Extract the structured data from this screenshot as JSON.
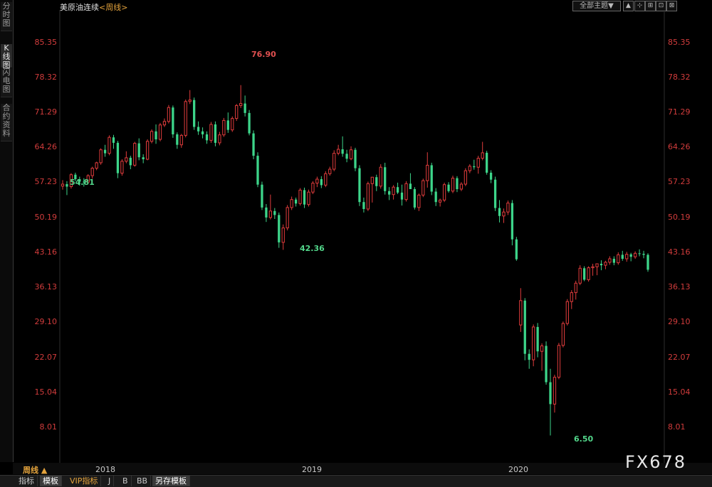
{
  "left_tabs": [
    {
      "label": "分时图"
    },
    {
      "label": "K线图",
      "active": true
    },
    {
      "label": "闪电图"
    },
    {
      "label": "合约资料"
    }
  ],
  "header": {
    "instrument": "美原油连续",
    "period_prefix": "<",
    "period": "周线",
    "period_suffix": ">",
    "theme_selector": "全部主题▼",
    "tool_buttons": [
      "▲",
      "⊹",
      "⊞",
      "⊡",
      "⊠"
    ]
  },
  "y_ticks": [
    "85.35",
    "78.32",
    "71.29",
    "64.26",
    "57.23",
    "50.19",
    "43.16",
    "36.13",
    "29.10",
    "22.07",
    "15.04",
    "8.01"
  ],
  "x_ticks": [
    "2018",
    "2019",
    "2020"
  ],
  "annotations": {
    "high_2018": "76.90",
    "low_2017": "54.81",
    "low_2018": "42.36",
    "low_2020": "6.50"
  },
  "period_label": "周线 ▲",
  "watermark": "FX678",
  "bottom_tabs": [
    {
      "label": "指标"
    },
    {
      "label": "模板",
      "active": true
    },
    {
      "label": "VIP指标",
      "vip": true
    },
    {
      "label": "J"
    },
    {
      "label": "B"
    },
    {
      "label": "BB"
    },
    {
      "label": "另存模板",
      "active": true
    }
  ],
  "colors": {
    "up": "#e03c3c",
    "down": "#3dd58a",
    "axis_text": "#d23c3c"
  },
  "chart_data": {
    "type": "candlestick",
    "title": "美原油连续",
    "period": "周线",
    "ylim": [
      1.0,
      92.0
    ],
    "x_labels": [
      "2018",
      "2019",
      "2020"
    ],
    "series": [
      {
        "name": "美原油连续",
        "candles": [
          [
            56.6,
            57.8,
            55.9,
            57.0
          ],
          [
            57.0,
            57.6,
            54.8,
            56.5
          ],
          [
            56.5,
            59.2,
            56.1,
            58.9
          ],
          [
            58.9,
            59.3,
            57.6,
            58.0
          ],
          [
            58.0,
            58.5,
            56.7,
            57.5
          ],
          [
            57.5,
            58.2,
            56.5,
            57.4
          ],
          [
            57.4,
            59.0,
            57.0,
            58.7
          ],
          [
            58.7,
            60.5,
            58.1,
            60.2
          ],
          [
            60.2,
            61.5,
            59.8,
            61.3
          ],
          [
            61.3,
            64.2,
            60.9,
            63.9
          ],
          [
            63.9,
            64.9,
            62.5,
            63.2
          ],
          [
            63.2,
            66.8,
            62.8,
            66.4
          ],
          [
            66.4,
            66.9,
            64.1,
            65.3
          ],
          [
            65.3,
            65.7,
            58.2,
            59.2
          ],
          [
            59.2,
            62.0,
            58.7,
            61.6
          ],
          [
            61.6,
            63.6,
            61.2,
            62.3
          ],
          [
            62.3,
            62.7,
            60.0,
            60.8
          ],
          [
            60.8,
            65.5,
            60.5,
            65.2
          ],
          [
            65.2,
            66.2,
            61.8,
            62.4
          ],
          [
            62.4,
            63.0,
            61.2,
            62.0
          ],
          [
            62.0,
            66.0,
            61.8,
            65.6
          ],
          [
            65.6,
            68.0,
            65.2,
            67.6
          ],
          [
            67.6,
            69.0,
            65.1,
            66.0
          ],
          [
            66.0,
            69.3,
            65.6,
            68.9
          ],
          [
            68.9,
            70.2,
            68.5,
            69.6
          ],
          [
            69.6,
            72.9,
            69.2,
            72.4
          ],
          [
            72.4,
            72.8,
            66.3,
            67.0
          ],
          [
            67.0,
            67.4,
            64.1,
            64.9
          ],
          [
            64.9,
            67.1,
            64.3,
            66.8
          ],
          [
            66.8,
            74.0,
            66.4,
            73.6
          ],
          [
            73.6,
            75.9,
            73.1,
            73.9
          ],
          [
            73.9,
            74.4,
            67.9,
            68.5
          ],
          [
            68.5,
            69.6,
            66.9,
            67.6
          ],
          [
            67.6,
            68.4,
            66.2,
            67.0
          ],
          [
            67.0,
            67.6,
            65.1,
            65.8
          ],
          [
            65.8,
            69.5,
            65.3,
            69.0
          ],
          [
            69.0,
            69.6,
            64.6,
            65.3
          ],
          [
            65.3,
            67.5,
            64.8,
            66.9
          ],
          [
            66.9,
            70.3,
            66.5,
            69.8
          ],
          [
            69.8,
            71.4,
            67.3,
            67.9
          ],
          [
            67.9,
            70.6,
            67.5,
            70.2
          ],
          [
            70.2,
            73.1,
            69.7,
            72.8
          ],
          [
            72.8,
            76.9,
            72.3,
            73.2
          ],
          [
            73.2,
            74.8,
            70.6,
            71.3
          ],
          [
            71.3,
            71.9,
            66.8,
            67.2
          ],
          [
            67.2,
            67.8,
            62.0,
            62.7
          ],
          [
            62.7,
            63.4,
            56.4,
            56.9
          ],
          [
            56.9,
            57.5,
            51.8,
            52.3
          ],
          [
            52.3,
            53.0,
            49.4,
            50.3
          ],
          [
            50.3,
            54.9,
            49.9,
            51.6
          ],
          [
            51.6,
            52.2,
            50.0,
            50.8
          ],
          [
            50.8,
            51.3,
            44.2,
            45.3
          ],
          [
            45.3,
            48.9,
            43.8,
            48.2
          ],
          [
            48.2,
            52.8,
            47.7,
            52.3
          ],
          [
            52.3,
            54.5,
            51.8,
            53.9
          ],
          [
            53.9,
            54.3,
            52.5,
            53.1
          ],
          [
            53.1,
            56.2,
            52.7,
            55.8
          ],
          [
            55.8,
            56.3,
            52.2,
            52.9
          ],
          [
            52.9,
            55.9,
            52.5,
            55.4
          ],
          [
            55.4,
            57.6,
            55.0,
            57.2
          ],
          [
            57.2,
            58.5,
            56.4,
            58.0
          ],
          [
            58.0,
            58.6,
            56.2,
            56.8
          ],
          [
            56.8,
            59.6,
            56.4,
            59.1
          ],
          [
            59.1,
            60.5,
            58.7,
            60.0
          ],
          [
            60.0,
            63.8,
            59.6,
            63.2
          ],
          [
            63.2,
            64.9,
            62.8,
            64.0
          ],
          [
            64.0,
            66.6,
            62.5,
            63.1
          ],
          [
            63.1,
            63.9,
            61.4,
            62.1
          ],
          [
            62.1,
            64.6,
            61.8,
            63.9
          ],
          [
            63.9,
            64.3,
            59.6,
            60.2
          ],
          [
            60.2,
            60.8,
            52.6,
            53.4
          ],
          [
            53.4,
            54.3,
            51.3,
            52.0
          ],
          [
            52.0,
            57.5,
            51.6,
            57.1
          ],
          [
            57.1,
            57.9,
            53.3,
            58.4
          ],
          [
            58.4,
            58.9,
            55.6,
            56.6
          ],
          [
            56.6,
            61.0,
            56.1,
            60.4
          ],
          [
            60.4,
            61.3,
            54.9,
            55.6
          ],
          [
            55.6,
            56.4,
            53.8,
            54.9
          ],
          [
            54.9,
            56.8,
            53.9,
            56.4
          ],
          [
            56.4,
            57.3,
            55.0,
            55.3
          ],
          [
            55.3,
            56.9,
            52.7,
            53.9
          ],
          [
            53.9,
            57.6,
            53.5,
            57.1
          ],
          [
            57.1,
            59.2,
            56.6,
            56.0
          ],
          [
            56.0,
            56.4,
            51.9,
            52.3
          ],
          [
            52.3,
            55.1,
            51.6,
            54.8
          ],
          [
            54.8,
            58.1,
            54.4,
            57.7
          ],
          [
            57.7,
            63.4,
            56.3,
            60.8
          ],
          [
            60.8,
            61.3,
            54.8,
            55.5
          ],
          [
            55.5,
            56.2,
            52.6,
            53.4
          ],
          [
            53.4,
            54.1,
            52.5,
            53.8
          ],
          [
            53.8,
            57.3,
            53.4,
            56.9
          ],
          [
            56.9,
            57.4,
            55.3,
            55.6
          ],
          [
            55.6,
            58.7,
            55.2,
            58.2
          ],
          [
            58.2,
            58.6,
            55.4,
            56.0
          ],
          [
            56.0,
            57.4,
            55.6,
            57.0
          ],
          [
            57.0,
            60.2,
            56.6,
            59.7
          ],
          [
            59.7,
            61.0,
            59.2,
            60.6
          ],
          [
            60.6,
            61.9,
            59.9,
            60.4
          ],
          [
            60.4,
            62.7,
            59.1,
            62.2
          ],
          [
            62.2,
            65.5,
            61.8,
            63.3
          ],
          [
            63.3,
            63.7,
            58.9,
            59.3
          ],
          [
            59.3,
            59.8,
            57.2,
            57.9
          ],
          [
            57.9,
            58.5,
            51.6,
            52.2
          ],
          [
            52.2,
            53.8,
            49.3,
            50.6
          ],
          [
            50.6,
            52.1,
            49.2,
            51.4
          ],
          [
            51.4,
            53.7,
            50.8,
            53.2
          ],
          [
            53.2,
            53.8,
            44.7,
            45.9
          ],
          [
            45.9,
            46.4,
            41.6,
            41.9
          ],
          [
            28.7,
            36.1,
            27.3,
            33.6
          ],
          [
            33.6,
            34.1,
            21.6,
            22.9
          ],
          [
            22.9,
            23.8,
            19.9,
            21.7
          ],
          [
            21.7,
            28.8,
            20.4,
            28.3
          ],
          [
            28.3,
            29.1,
            22.2,
            23.4
          ],
          [
            23.4,
            25.0,
            19.5,
            24.5
          ],
          [
            24.5,
            25.4,
            16.7,
            17.2
          ],
          [
            17.2,
            19.9,
            6.5,
            12.8
          ],
          [
            12.8,
            18.7,
            11.1,
            18.2
          ],
          [
            18.2,
            25.1,
            17.8,
            24.6
          ],
          [
            24.6,
            29.4,
            24.2,
            29.0
          ],
          [
            29.0,
            33.9,
            28.6,
            33.4
          ],
          [
            33.4,
            35.7,
            31.9,
            35.2
          ],
          [
            35.2,
            37.6,
            33.8,
            37.1
          ],
          [
            37.1,
            40.7,
            36.7,
            40.1
          ],
          [
            40.1,
            40.5,
            37.5,
            37.8
          ],
          [
            37.8,
            40.5,
            37.4,
            40.2
          ],
          [
            40.2,
            41.0,
            38.6,
            40.4
          ],
          [
            40.4,
            40.9,
            38.7,
            41.0
          ],
          [
            41.0,
            41.7,
            39.7,
            40.7
          ],
          [
            40.7,
            41.6,
            39.9,
            41.3
          ],
          [
            41.3,
            42.5,
            40.8,
            42.0
          ],
          [
            42.0,
            42.5,
            40.7,
            41.2
          ],
          [
            41.2,
            43.3,
            40.8,
            42.8
          ],
          [
            42.8,
            43.6,
            41.6,
            42.0
          ],
          [
            42.0,
            43.4,
            41.4,
            42.9
          ],
          [
            42.9,
            43.2,
            41.5,
            42.4
          ],
          [
            42.4,
            43.5,
            42.0,
            43.1
          ],
          [
            43.1,
            43.9,
            42.5,
            43.0
          ],
          [
            43.0,
            43.6,
            42.1,
            42.8
          ],
          [
            42.8,
            43.1,
            39.4,
            39.8
          ]
        ]
      }
    ],
    "candle_format": [
      "open",
      "high",
      "low",
      "close"
    ],
    "grid": false
  }
}
